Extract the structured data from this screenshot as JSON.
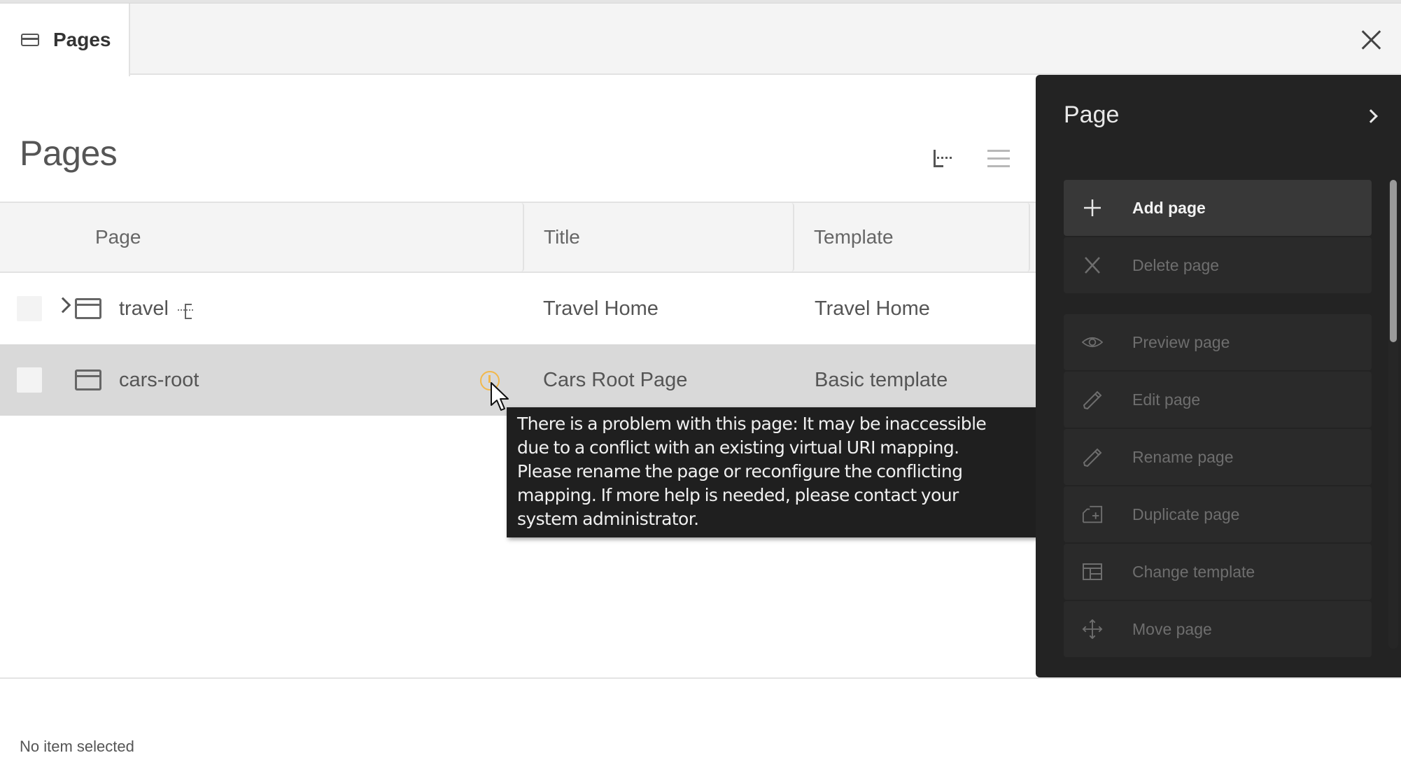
{
  "window": {
    "tab_label": "Pages",
    "tab_icon": "page-icon",
    "close_icon": "close-icon"
  },
  "main": {
    "heading": "Pages",
    "view_toggles": [
      {
        "name": "tree-view",
        "icon": "tree-view-icon",
        "active": true
      },
      {
        "name": "list-view",
        "icon": "list-view-icon",
        "active": false
      }
    ],
    "columns": [
      "Page",
      "Title",
      "Template"
    ],
    "rows": [
      {
        "name": "travel",
        "title": "Travel Home",
        "template": "Travel Home",
        "expandable": true,
        "site_root": true,
        "warning": false,
        "selected": false
      },
      {
        "name": "cars-root",
        "title": "Cars Root Page",
        "template": "Basic template",
        "expandable": false,
        "site_root": false,
        "warning": true,
        "selected": true
      }
    ],
    "status": "No item selected"
  },
  "tooltip": {
    "text": "There is a problem with this page: It may be inaccessible\ndue to a conflict with an existing virtual URI mapping.\nPlease rename the page or reconfigure the conflicting\nmapping. If more help is needed, please contact your\nsystem administrator."
  },
  "panel": {
    "title": "Page",
    "actions": [
      {
        "label": "Add page",
        "icon": "plus-icon",
        "enabled": true
      },
      {
        "label": "Delete page",
        "icon": "x-icon",
        "enabled": false
      },
      {
        "label": "Preview page",
        "icon": "eye-icon",
        "enabled": false
      },
      {
        "label": "Edit page",
        "icon": "pencil-icon",
        "enabled": false
      },
      {
        "label": "Rename page",
        "icon": "pencil-icon",
        "enabled": false
      },
      {
        "label": "Duplicate page",
        "icon": "duplicate-icon",
        "enabled": false
      },
      {
        "label": "Change template",
        "icon": "template-icon",
        "enabled": false
      },
      {
        "label": "Move page",
        "icon": "move-icon",
        "enabled": false
      }
    ]
  },
  "colors": {
    "panel_bg": "#232323",
    "warning": "#f2b84b",
    "selected_row": "#d9d9d9",
    "tooltip_bg": "#1f1f1f"
  }
}
